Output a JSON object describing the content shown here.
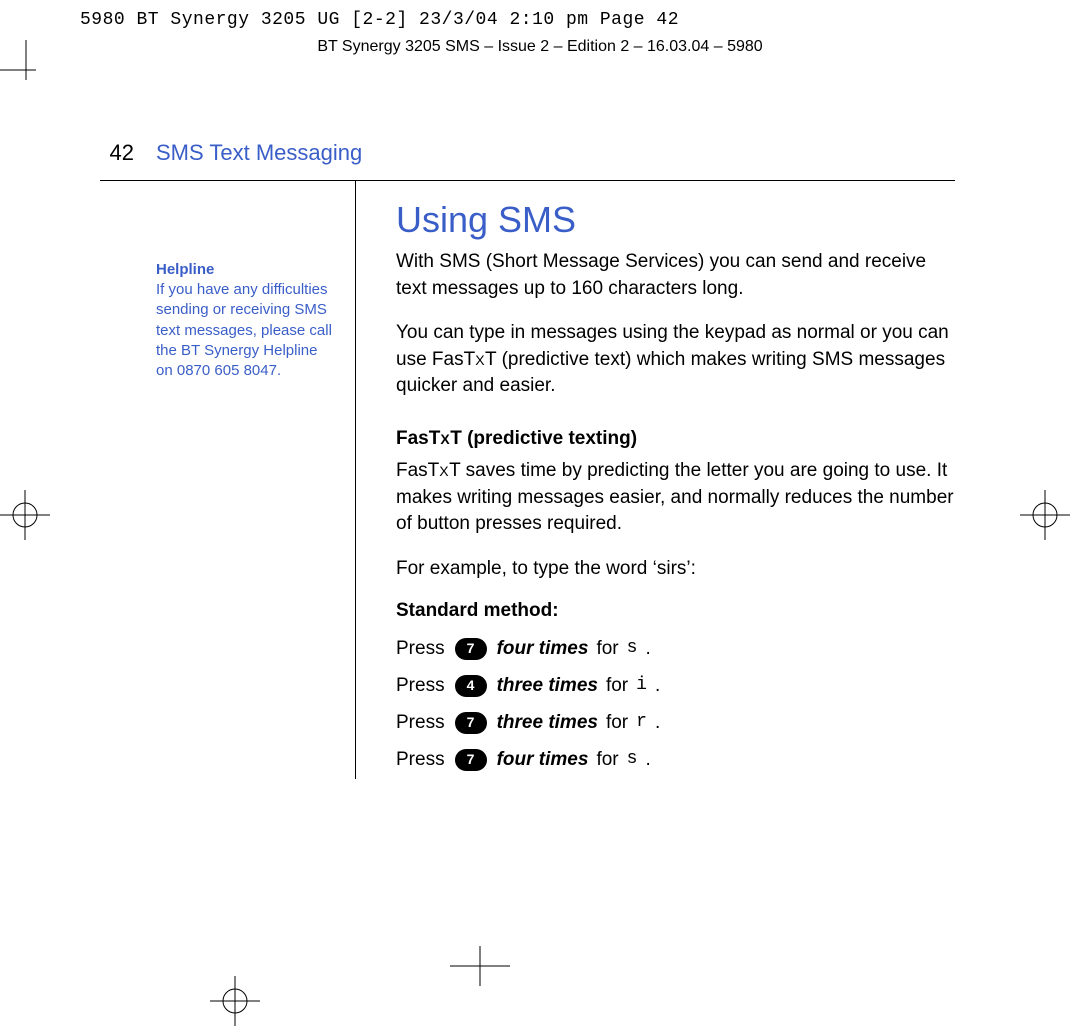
{
  "slug": "5980 BT Synergy 3205 UG [2-2]  23/3/04  2:10 pm  Page 42",
  "running_head": "BT Synergy 3205 SMS – Issue 2 – Edition 2 – 16.03.04 – 5980",
  "page_number": "42",
  "section_title": "SMS Text Messaging",
  "sidebar": {
    "heading": "Helpline",
    "body": "If you have any difficulties sending or receiving SMS text messages, please call the BT Synergy Helpline on 0870 605 8047."
  },
  "main": {
    "title": "Using SMS",
    "intro1": "With SMS (Short Message Services) you can send and receive text messages up to 160 characters long.",
    "intro2_a": "You can type in messages using the keypad as normal or you can use FasT",
    "intro2_mid": "X",
    "intro2_b": "T (predictive text) which makes writing SMS messages quicker and easier.",
    "fastxt_heading_a": "FasT",
    "fastxt_heading_mid": "X",
    "fastxt_heading_b": "T (predictive texting)",
    "fastxt_body_a": "FasT",
    "fastxt_body_mid": "X",
    "fastxt_body_b": "T saves time by predicting the letter you are going to use. It makes writing messages easier, and normally reduces the number of button presses required.",
    "example_line": "For example, to type the word ‘sirs’:",
    "standard_heading": "Standard method:",
    "press": "Press",
    "for": "for",
    "dot": ".",
    "steps": [
      {
        "key": "7",
        "times": "four times",
        "letter": "s"
      },
      {
        "key": "4",
        "times": "three times",
        "letter": "i"
      },
      {
        "key": "7",
        "times": "three times",
        "letter": "r"
      },
      {
        "key": "7",
        "times": "four times",
        "letter": "s"
      }
    ]
  }
}
